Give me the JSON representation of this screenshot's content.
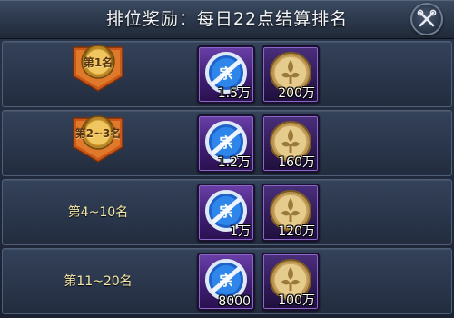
{
  "header": {
    "title": "排位奖励：每日22点结算排名"
  },
  "rewards": [
    {
      "rank_label": "第1名",
      "medal": true,
      "items": [
        {
          "icon": "blue-ticket-icon",
          "amount": "1.5万"
        },
        {
          "icon": "gold-coin-icon",
          "amount": "200万"
        }
      ]
    },
    {
      "rank_label": "第2~3名",
      "medal": true,
      "items": [
        {
          "icon": "blue-ticket-icon",
          "amount": "1.2万"
        },
        {
          "icon": "gold-coin-icon",
          "amount": "160万"
        }
      ]
    },
    {
      "rank_label": "第4~10名",
      "medal": false,
      "items": [
        {
          "icon": "blue-ticket-icon",
          "amount": "1万"
        },
        {
          "icon": "gold-coin-icon",
          "amount": "120万"
        }
      ]
    },
    {
      "rank_label": "第11~20名",
      "medal": false,
      "items": [
        {
          "icon": "blue-ticket-icon",
          "amount": "8000"
        },
        {
          "icon": "gold-coin-icon",
          "amount": "100万"
        }
      ]
    }
  ],
  "colors": {
    "rank_text": "#f4e9a8",
    "medal_gold": "#e8b64a",
    "medal_ribbon": "#d9661c",
    "slot_purple": "#5a3296"
  }
}
